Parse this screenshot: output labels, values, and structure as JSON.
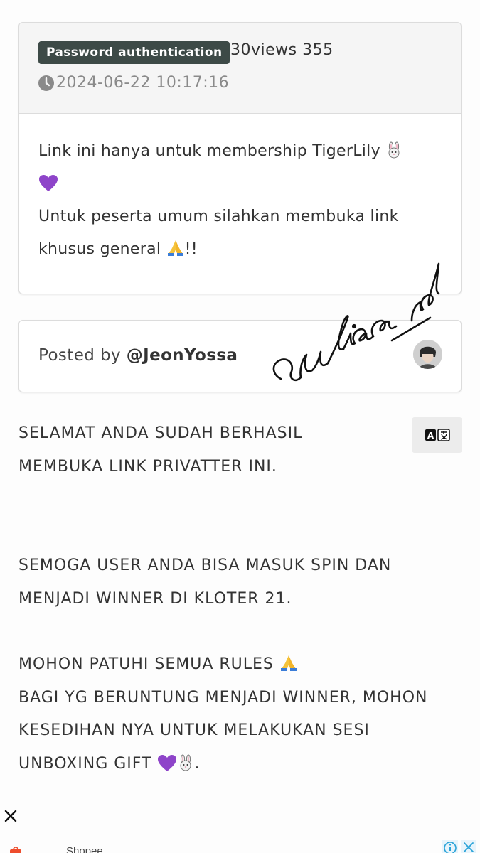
{
  "post": {
    "badge": "Password authentication",
    "views": "30views 355",
    "date": "2024-06-22 10:17:16",
    "line1": "Link ini hanya untuk membership TigerLily",
    "line2": "Untuk peserta umum silahkan membuka link",
    "line3": "khusus general",
    "line3_tail": "!!"
  },
  "author": {
    "prefix": "Posted by",
    "handle": "@JeonYossa"
  },
  "signature_text": "auliaa_rd",
  "content": {
    "p1_l1": "SELAMAT ANDA SUDAH BERHASIL",
    "p1_l2": "MEMBUKA LINK PRIVATTER INI.",
    "p2_l1": "SEMOGA USER ANDA BISA MASUK SPIN DAN",
    "p2_l2": "MENJADI WINNER DI KLOTER 21.",
    "p3_l1": "MOHON PATUHI SEMUA RULES",
    "p3_l2": "BAGI YG BERUNTUNG MENJADI WINNER, MOHON",
    "p3_l3": "KESEDIHAN NYA UNTUK MELAKUKAN SESI",
    "p3_l4": "UNBOXING GIFT",
    "p3_l4_tail": "."
  },
  "ad": {
    "label": "Shopee"
  },
  "icons": {
    "clock": "clock-icon",
    "translate": "translate-icon",
    "close": "close-icon",
    "rabbit": "rabbit-emoji",
    "heart": "purple-heart-emoji",
    "pray": "folded-hands-emoji"
  },
  "colors": {
    "badge_bg": "#3d4a47",
    "heart": "#8e44c9",
    "signature_ink": "#111111"
  }
}
